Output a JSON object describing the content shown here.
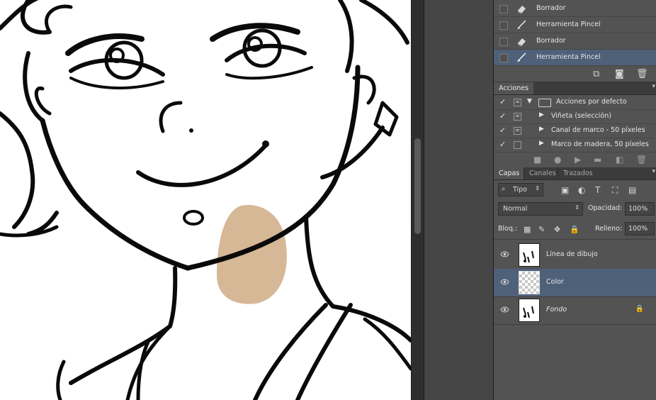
{
  "history": {
    "items": [
      {
        "label": "Borrador",
        "icon": "eraser-icon"
      },
      {
        "label": "Herramienta Pincel",
        "icon": "brush-icon"
      },
      {
        "label": "Borrador",
        "icon": "eraser-icon"
      },
      {
        "label": "Herramienta Pincel",
        "icon": "brush-icon",
        "active": true
      }
    ]
  },
  "actions": {
    "tab": "Acciones",
    "items": [
      {
        "label": "Acciones por defecto"
      },
      {
        "label": "Viñeta (selección)"
      },
      {
        "label": "Canal de marco - 50 píxeles"
      },
      {
        "label": "Marco de madera, 50 píxeles"
      }
    ]
  },
  "layers_panel": {
    "tabs": [
      "Capas",
      "Canales",
      "Trazados"
    ],
    "filter_kind": "Tipo",
    "blend_mode": "Normal",
    "opacity_label": "Opacidad:",
    "opacity_value": "100%",
    "lock_label": "Bloq.:",
    "fill_label": "Relleno:",
    "fill_value": "100%",
    "layers": [
      {
        "name": "Línea de dibujo",
        "thumb": "sketch"
      },
      {
        "name": "Color",
        "thumb": "transparent",
        "active": true
      },
      {
        "name": "Fondo",
        "thumb": "sketch",
        "locked": true
      }
    ]
  },
  "colors": {
    "accent": "#4f6079",
    "panel_bg": "#535353",
    "skin_tone": "#d6b796"
  }
}
